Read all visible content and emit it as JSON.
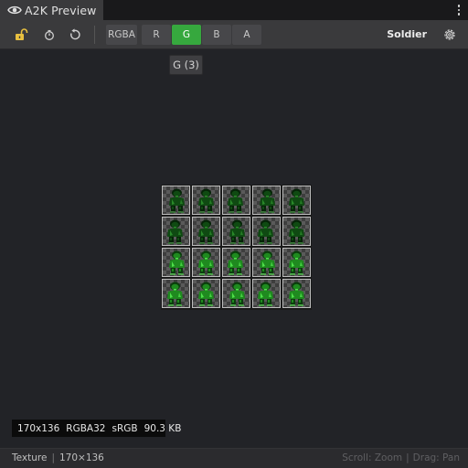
{
  "window": {
    "title": "A2K Preview"
  },
  "toolbar": {
    "lock_icon": "unlock-icon",
    "clock_icon": "timer-icon",
    "reset_icon": "rotate-icon",
    "channels": [
      {
        "label": "RGBA",
        "active": false
      },
      {
        "label": "R",
        "active": false
      },
      {
        "label": "G",
        "active": true
      },
      {
        "label": "B",
        "active": false
      },
      {
        "label": "A",
        "active": false
      }
    ],
    "asset_name": "Soldier",
    "settings_icon": "gear-icon"
  },
  "tooltip": {
    "text": "G (3)"
  },
  "sprite_sheet": {
    "rows": 4,
    "columns": 5
  },
  "info": {
    "dimensions": "170x136",
    "format": "RGBA32",
    "color_space": "sRGB",
    "size": "90.3 KB"
  },
  "status": {
    "type": "Texture",
    "dimensions": "170×136",
    "hint_scroll": "Scroll: Zoom",
    "hint_drag": "Drag: Pan"
  },
  "colors": {
    "active_channel": "#36a83e",
    "background": "#222327",
    "toolbar": "#3a3a3c"
  }
}
